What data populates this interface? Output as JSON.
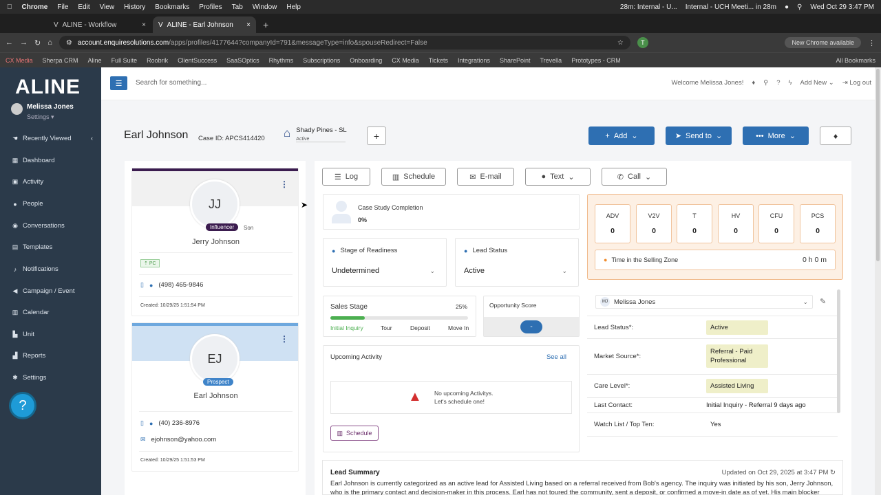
{
  "macbar": {
    "app": "Chrome",
    "menus": [
      "File",
      "Edit",
      "View",
      "History",
      "Bookmarks",
      "Profiles",
      "Tab",
      "Window",
      "Help"
    ],
    "timer": "28m: Internal - U...",
    "meeting": "Internal - UCH Meeti... in 28m",
    "datetime": "Wed Oct 29  3:47 PM"
  },
  "tabs": [
    {
      "label": "ALINE - Workflow"
    },
    {
      "label": "ALINE - Earl Johnson"
    }
  ],
  "url": {
    "host": "account.enquiresolutions.com",
    "path": "/apps/profiles/4177644?companyId=791&messageType=info&spouseRedirect=False",
    "chrome_available": "New Chrome available",
    "profile_initial": "T"
  },
  "bookmarks": [
    "CX Media",
    "Sherpa CRM",
    "Aline",
    "Full Suite",
    "Roobrik",
    "ClientSuccess",
    "SaaSOptics",
    "Rhythms",
    "Subscriptions",
    "Onboarding",
    "CX Media",
    "Tickets",
    "Integrations",
    "SharePoint",
    "Trevella",
    "Prototypes - CRM",
    "All Bookmarks"
  ],
  "sidebar": {
    "logo": "ALINE",
    "user": "Melissa Jones",
    "settings": "Settings",
    "items": [
      {
        "label": "Recently Viewed",
        "icon": "hand-icon"
      },
      {
        "label": "Dashboard",
        "icon": "dashboard-icon"
      },
      {
        "label": "Activity",
        "icon": "activity-icon"
      },
      {
        "label": "People",
        "icon": "person-icon"
      },
      {
        "label": "Conversations",
        "icon": "chat-icon"
      },
      {
        "label": "Templates",
        "icon": "template-icon"
      },
      {
        "label": "Notifications",
        "icon": "bell-icon"
      },
      {
        "label": "Campaign / Event",
        "icon": "megaphone-icon"
      },
      {
        "label": "Calendar",
        "icon": "calendar-icon"
      },
      {
        "label": "Unit",
        "icon": "building-icon"
      },
      {
        "label": "Reports",
        "icon": "chart-icon"
      },
      {
        "label": "Settings",
        "icon": "gear-icon"
      }
    ]
  },
  "header": {
    "search_placeholder": "Search for something...",
    "welcome": "Welcome Melissa Jones!",
    "add_new": "Add New",
    "logout": "Log out"
  },
  "profile": {
    "name": "Earl Johnson",
    "case_id": "Case ID: APCS414420",
    "community": "Shady Pines - SL",
    "community_status": "Active",
    "buttons": {
      "add": "Add",
      "send": "Send to",
      "more": "More"
    }
  },
  "contacts": [
    {
      "initials": "JJ",
      "role": "Influencer",
      "relation": "Son",
      "name": "Jerry Johnson",
      "tag": "PC",
      "phone": "(498) 465-9846",
      "created": "Created: 10/29/25 1:51:54 PM"
    },
    {
      "initials": "EJ",
      "role": "Prospect",
      "name": "Earl Johnson",
      "phone": "(40) 236-8976",
      "email": "ejohnson@yahoo.com",
      "created": "Created: 10/29/25 1:51:53 PM"
    }
  ],
  "actions": {
    "log": "Log",
    "schedule": "Schedule",
    "email": "E-mail",
    "text": "Text",
    "call": "Call"
  },
  "case_study": {
    "label": "Case Study Completion",
    "value": "0%"
  },
  "readiness": {
    "label": "Stage of Readiness",
    "value": "Undetermined"
  },
  "lead_status": {
    "label": "Lead Status",
    "value": "Active"
  },
  "sales_stage": {
    "label": "Sales Stage",
    "percent": "25%",
    "progress": 0.25,
    "stages": [
      "Initial Inquiry",
      "Tour",
      "Deposit",
      "Move In"
    ]
  },
  "opportunity": {
    "label": "Opportunity Score",
    "value": "-"
  },
  "upcoming": {
    "label": "Upcoming Activity",
    "see_all": "See all",
    "empty1": "No upcoming Activitys.",
    "empty2": "Let's schedule one!",
    "schedule": "Schedule"
  },
  "counters": [
    {
      "key": "ADV",
      "value": "0"
    },
    {
      "key": "V2V",
      "value": "0"
    },
    {
      "key": "T",
      "value": "0"
    },
    {
      "key": "HV",
      "value": "0"
    },
    {
      "key": "CFU",
      "value": "0"
    },
    {
      "key": "PCS",
      "value": "0"
    }
  ],
  "selling_zone": {
    "label": "Time in the Selling Zone",
    "value": "0 h 0 m"
  },
  "details": {
    "owner_initials": "MJ",
    "owner": "Melissa Jones",
    "rows": [
      {
        "key": "Lead Status*:",
        "value": "Active"
      },
      {
        "key": "Market Source*:",
        "value": "Referral - Paid Professional"
      },
      {
        "key": "Care Level*:",
        "value": "Assisted Living"
      },
      {
        "key": "Last Contact:",
        "value": "Initial Inquiry - Referral 9 days ago"
      },
      {
        "key": "Watch List / Top Ten:",
        "value": "Yes"
      }
    ]
  },
  "summary": {
    "title": "Lead Summary",
    "updated": "Updated on Oct 29, 2025 at 3:47 PM",
    "text": "Earl Johnson is currently categorized as an active lead for Assisted Living based on a referral received from Bob's agency. The inquiry was initiated by his son, Jerry Johnson, who is the primary contact and decision-maker in this process. Earl has not toured the community, sent a deposit, or confirmed a move-in date as of yet. His main blocker appears"
  },
  "colors": {
    "primary": "#2e6fb2",
    "sidebar": "#2b3a4a",
    "influencer": "#3b1c4f",
    "prospect_band": "#cfe1f3",
    "progress": "#4caf50"
  }
}
